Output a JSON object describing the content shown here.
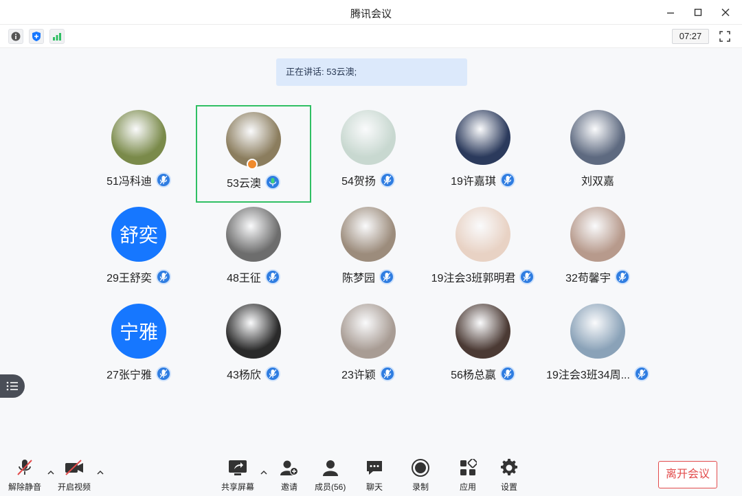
{
  "window": {
    "title": "腾讯会议"
  },
  "top_bar": {
    "timer": "07:27"
  },
  "speaking_banner": "正在讲话: 53云澳;",
  "participants": [
    {
      "name": "51冯科迪",
      "avatar_type": "photo",
      "color": "#7a8a4a"
    },
    {
      "name": "53云澳",
      "avatar_type": "photo",
      "color": "#8b7d5e",
      "active": true,
      "host": true
    },
    {
      "name": "54贺扬",
      "avatar_type": "photo",
      "color": "#c8d8d0"
    },
    {
      "name": "19许嘉琪",
      "avatar_type": "photo",
      "color": "#2b3a5c"
    },
    {
      "name": "刘双嘉",
      "avatar_type": "photo",
      "color": "#5e6a80",
      "no_mic": true
    },
    {
      "name": "29王舒奕",
      "avatar_type": "text",
      "avatar_text": "舒奕"
    },
    {
      "name": "48王征",
      "avatar_type": "photo",
      "color": "#6d6d6d"
    },
    {
      "name": "陈梦园",
      "avatar_type": "photo",
      "color": "#9c8c7c"
    },
    {
      "name": "19注会3班郭明君",
      "avatar_type": "photo",
      "color": "#e8d2c4"
    },
    {
      "name": "32苟馨宇",
      "avatar_type": "photo",
      "color": "#b79a8c"
    },
    {
      "name": "27张宁雅",
      "avatar_type": "text",
      "avatar_text": "宁雅"
    },
    {
      "name": "43杨欣",
      "avatar_type": "photo",
      "color": "#2a2a2a"
    },
    {
      "name": "23许颖",
      "avatar_type": "photo",
      "color": "#a89c94"
    },
    {
      "name": "56杨总嬴",
      "avatar_type": "photo",
      "color": "#4b3a34"
    },
    {
      "name": "19注会3班34周...",
      "avatar_type": "photo",
      "color": "#8aa2b8"
    }
  ],
  "bottom_bar": {
    "unmute": "解除静音",
    "start_video": "开启视频",
    "share_screen": "共享屏幕",
    "invite": "邀请",
    "members": "成员(56)",
    "chat": "聊天",
    "record": "录制",
    "apps": "应用",
    "settings": "设置",
    "leave": "离开会议"
  },
  "colors": {
    "accent": "#1677ff",
    "active_border": "#2fbf63",
    "leave_red": "#e24a4a",
    "banner": "#dce9fb"
  }
}
